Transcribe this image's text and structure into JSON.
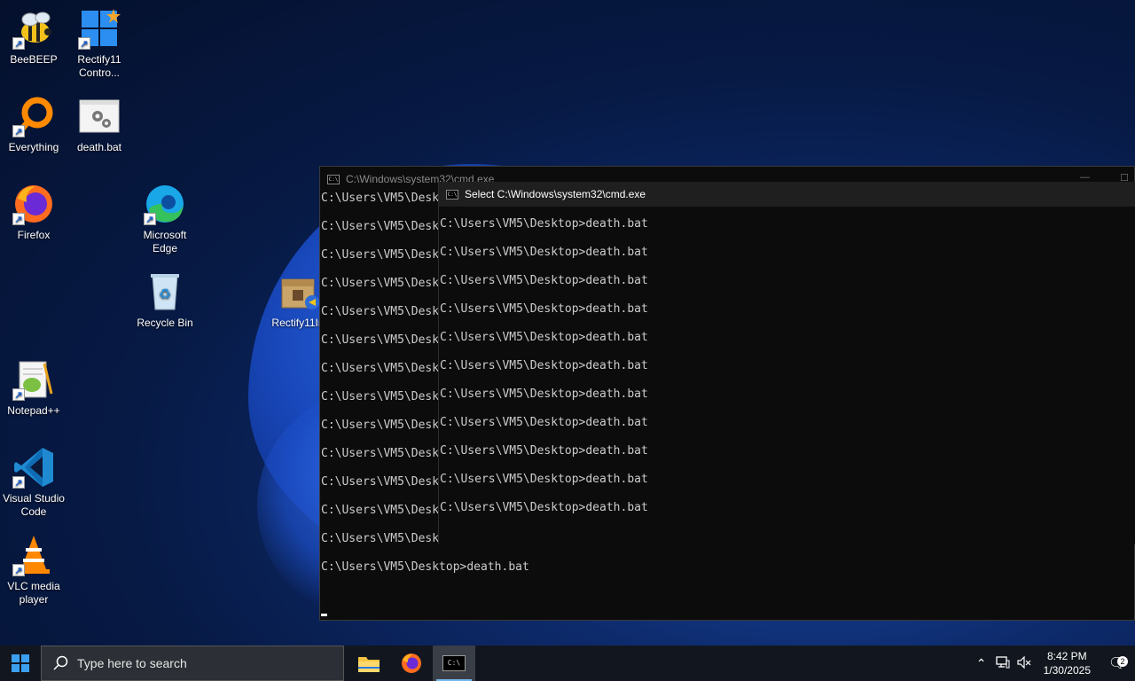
{
  "desktop": {
    "icons": [
      {
        "label": "BeeBEEP"
      },
      {
        "label": "Rectify11\nContro..."
      },
      {
        "label": "Everything"
      },
      {
        "label": "death.bat"
      },
      {
        "label": "Firefox"
      },
      {
        "label": "Microsoft\nEdge"
      },
      {
        "label": "Recycle Bin"
      },
      {
        "label": "Rectify11In"
      },
      {
        "label": "Notepad++"
      },
      {
        "label": "Visual Studio\nCode"
      },
      {
        "label": "VLC media\nplayer"
      }
    ]
  },
  "cmd_back": {
    "title": "C:\\Windows\\system32\\cmd.exe",
    "lines": [
      "C:\\Users\\VM5\\Desk",
      "C:\\Users\\VM5\\Desk",
      "C:\\Users\\VM5\\Desk",
      "C:\\Users\\VM5\\Desk",
      "C:\\Users\\VM5\\Desk",
      "C:\\Users\\VM5\\Desk",
      "C:\\Users\\VM5\\Desk",
      "C:\\Users\\VM5\\Desk",
      "C:\\Users\\VM5\\Desk",
      "C:\\Users\\VM5\\Desk",
      "C:\\Users\\VM5\\Desk",
      "C:\\Users\\VM5\\Desk",
      "C:\\Users\\VM5\\Desktop>death.bat",
      "C:\\Users\\VM5\\Desktop>death.bat"
    ]
  },
  "cmd_front": {
    "title": "Select C:\\Windows\\system32\\cmd.exe",
    "lines": [
      "C:\\Users\\VM5\\Desktop>death.bat",
      "C:\\Users\\VM5\\Desktop>death.bat",
      "C:\\Users\\VM5\\Desktop>death.bat",
      "C:\\Users\\VM5\\Desktop>death.bat",
      "C:\\Users\\VM5\\Desktop>death.bat",
      "C:\\Users\\VM5\\Desktop>death.bat",
      "C:\\Users\\VM5\\Desktop>death.bat",
      "C:\\Users\\VM5\\Desktop>death.bat",
      "C:\\Users\\VM5\\Desktop>death.bat",
      "C:\\Users\\VM5\\Desktop>death.bat",
      "C:\\Users\\VM5\\Desktop>death.bat"
    ]
  },
  "taskbar": {
    "search_placeholder": "Type here to search",
    "time": "8:42 PM",
    "date": "1/30/2025",
    "notification_count": "2"
  }
}
